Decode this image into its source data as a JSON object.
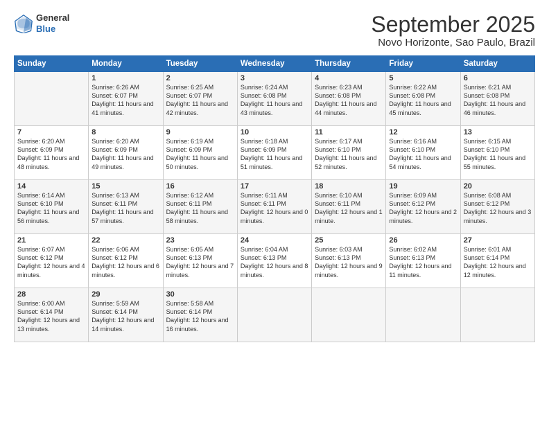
{
  "logo": {
    "general": "General",
    "blue": "Blue"
  },
  "header": {
    "month": "September 2025",
    "location": "Novo Horizonte, Sao Paulo, Brazil"
  },
  "days_of_week": [
    "Sunday",
    "Monday",
    "Tuesday",
    "Wednesday",
    "Thursday",
    "Friday",
    "Saturday"
  ],
  "weeks": [
    [
      {
        "day": "",
        "sunrise": "",
        "sunset": "",
        "daylight": ""
      },
      {
        "day": "1",
        "sunrise": "Sunrise: 6:26 AM",
        "sunset": "Sunset: 6:07 PM",
        "daylight": "Daylight: 11 hours and 41 minutes."
      },
      {
        "day": "2",
        "sunrise": "Sunrise: 6:25 AM",
        "sunset": "Sunset: 6:07 PM",
        "daylight": "Daylight: 11 hours and 42 minutes."
      },
      {
        "day": "3",
        "sunrise": "Sunrise: 6:24 AM",
        "sunset": "Sunset: 6:08 PM",
        "daylight": "Daylight: 11 hours and 43 minutes."
      },
      {
        "day": "4",
        "sunrise": "Sunrise: 6:23 AM",
        "sunset": "Sunset: 6:08 PM",
        "daylight": "Daylight: 11 hours and 44 minutes."
      },
      {
        "day": "5",
        "sunrise": "Sunrise: 6:22 AM",
        "sunset": "Sunset: 6:08 PM",
        "daylight": "Daylight: 11 hours and 45 minutes."
      },
      {
        "day": "6",
        "sunrise": "Sunrise: 6:21 AM",
        "sunset": "Sunset: 6:08 PM",
        "daylight": "Daylight: 11 hours and 46 minutes."
      }
    ],
    [
      {
        "day": "7",
        "sunrise": "Sunrise: 6:20 AM",
        "sunset": "Sunset: 6:09 PM",
        "daylight": "Daylight: 11 hours and 48 minutes."
      },
      {
        "day": "8",
        "sunrise": "Sunrise: 6:20 AM",
        "sunset": "Sunset: 6:09 PM",
        "daylight": "Daylight: 11 hours and 49 minutes."
      },
      {
        "day": "9",
        "sunrise": "Sunrise: 6:19 AM",
        "sunset": "Sunset: 6:09 PM",
        "daylight": "Daylight: 11 hours and 50 minutes."
      },
      {
        "day": "10",
        "sunrise": "Sunrise: 6:18 AM",
        "sunset": "Sunset: 6:09 PM",
        "daylight": "Daylight: 11 hours and 51 minutes."
      },
      {
        "day": "11",
        "sunrise": "Sunrise: 6:17 AM",
        "sunset": "Sunset: 6:10 PM",
        "daylight": "Daylight: 11 hours and 52 minutes."
      },
      {
        "day": "12",
        "sunrise": "Sunrise: 6:16 AM",
        "sunset": "Sunset: 6:10 PM",
        "daylight": "Daylight: 11 hours and 54 minutes."
      },
      {
        "day": "13",
        "sunrise": "Sunrise: 6:15 AM",
        "sunset": "Sunset: 6:10 PM",
        "daylight": "Daylight: 11 hours and 55 minutes."
      }
    ],
    [
      {
        "day": "14",
        "sunrise": "Sunrise: 6:14 AM",
        "sunset": "Sunset: 6:10 PM",
        "daylight": "Daylight: 11 hours and 56 minutes."
      },
      {
        "day": "15",
        "sunrise": "Sunrise: 6:13 AM",
        "sunset": "Sunset: 6:11 PM",
        "daylight": "Daylight: 11 hours and 57 minutes."
      },
      {
        "day": "16",
        "sunrise": "Sunrise: 6:12 AM",
        "sunset": "Sunset: 6:11 PM",
        "daylight": "Daylight: 11 hours and 58 minutes."
      },
      {
        "day": "17",
        "sunrise": "Sunrise: 6:11 AM",
        "sunset": "Sunset: 6:11 PM",
        "daylight": "Daylight: 12 hours and 0 minutes."
      },
      {
        "day": "18",
        "sunrise": "Sunrise: 6:10 AM",
        "sunset": "Sunset: 6:11 PM",
        "daylight": "Daylight: 12 hours and 1 minute."
      },
      {
        "day": "19",
        "sunrise": "Sunrise: 6:09 AM",
        "sunset": "Sunset: 6:12 PM",
        "daylight": "Daylight: 12 hours and 2 minutes."
      },
      {
        "day": "20",
        "sunrise": "Sunrise: 6:08 AM",
        "sunset": "Sunset: 6:12 PM",
        "daylight": "Daylight: 12 hours and 3 minutes."
      }
    ],
    [
      {
        "day": "21",
        "sunrise": "Sunrise: 6:07 AM",
        "sunset": "Sunset: 6:12 PM",
        "daylight": "Daylight: 12 hours and 4 minutes."
      },
      {
        "day": "22",
        "sunrise": "Sunrise: 6:06 AM",
        "sunset": "Sunset: 6:12 PM",
        "daylight": "Daylight: 12 hours and 6 minutes."
      },
      {
        "day": "23",
        "sunrise": "Sunrise: 6:05 AM",
        "sunset": "Sunset: 6:13 PM",
        "daylight": "Daylight: 12 hours and 7 minutes."
      },
      {
        "day": "24",
        "sunrise": "Sunrise: 6:04 AM",
        "sunset": "Sunset: 6:13 PM",
        "daylight": "Daylight: 12 hours and 8 minutes."
      },
      {
        "day": "25",
        "sunrise": "Sunrise: 6:03 AM",
        "sunset": "Sunset: 6:13 PM",
        "daylight": "Daylight: 12 hours and 9 minutes."
      },
      {
        "day": "26",
        "sunrise": "Sunrise: 6:02 AM",
        "sunset": "Sunset: 6:13 PM",
        "daylight": "Daylight: 12 hours and 11 minutes."
      },
      {
        "day": "27",
        "sunrise": "Sunrise: 6:01 AM",
        "sunset": "Sunset: 6:14 PM",
        "daylight": "Daylight: 12 hours and 12 minutes."
      }
    ],
    [
      {
        "day": "28",
        "sunrise": "Sunrise: 6:00 AM",
        "sunset": "Sunset: 6:14 PM",
        "daylight": "Daylight: 12 hours and 13 minutes."
      },
      {
        "day": "29",
        "sunrise": "Sunrise: 5:59 AM",
        "sunset": "Sunset: 6:14 PM",
        "daylight": "Daylight: 12 hours and 14 minutes."
      },
      {
        "day": "30",
        "sunrise": "Sunrise: 5:58 AM",
        "sunset": "Sunset: 6:14 PM",
        "daylight": "Daylight: 12 hours and 16 minutes."
      },
      {
        "day": "",
        "sunrise": "",
        "sunset": "",
        "daylight": ""
      },
      {
        "day": "",
        "sunrise": "",
        "sunset": "",
        "daylight": ""
      },
      {
        "day": "",
        "sunrise": "",
        "sunset": "",
        "daylight": ""
      },
      {
        "day": "",
        "sunrise": "",
        "sunset": "",
        "daylight": ""
      }
    ]
  ]
}
